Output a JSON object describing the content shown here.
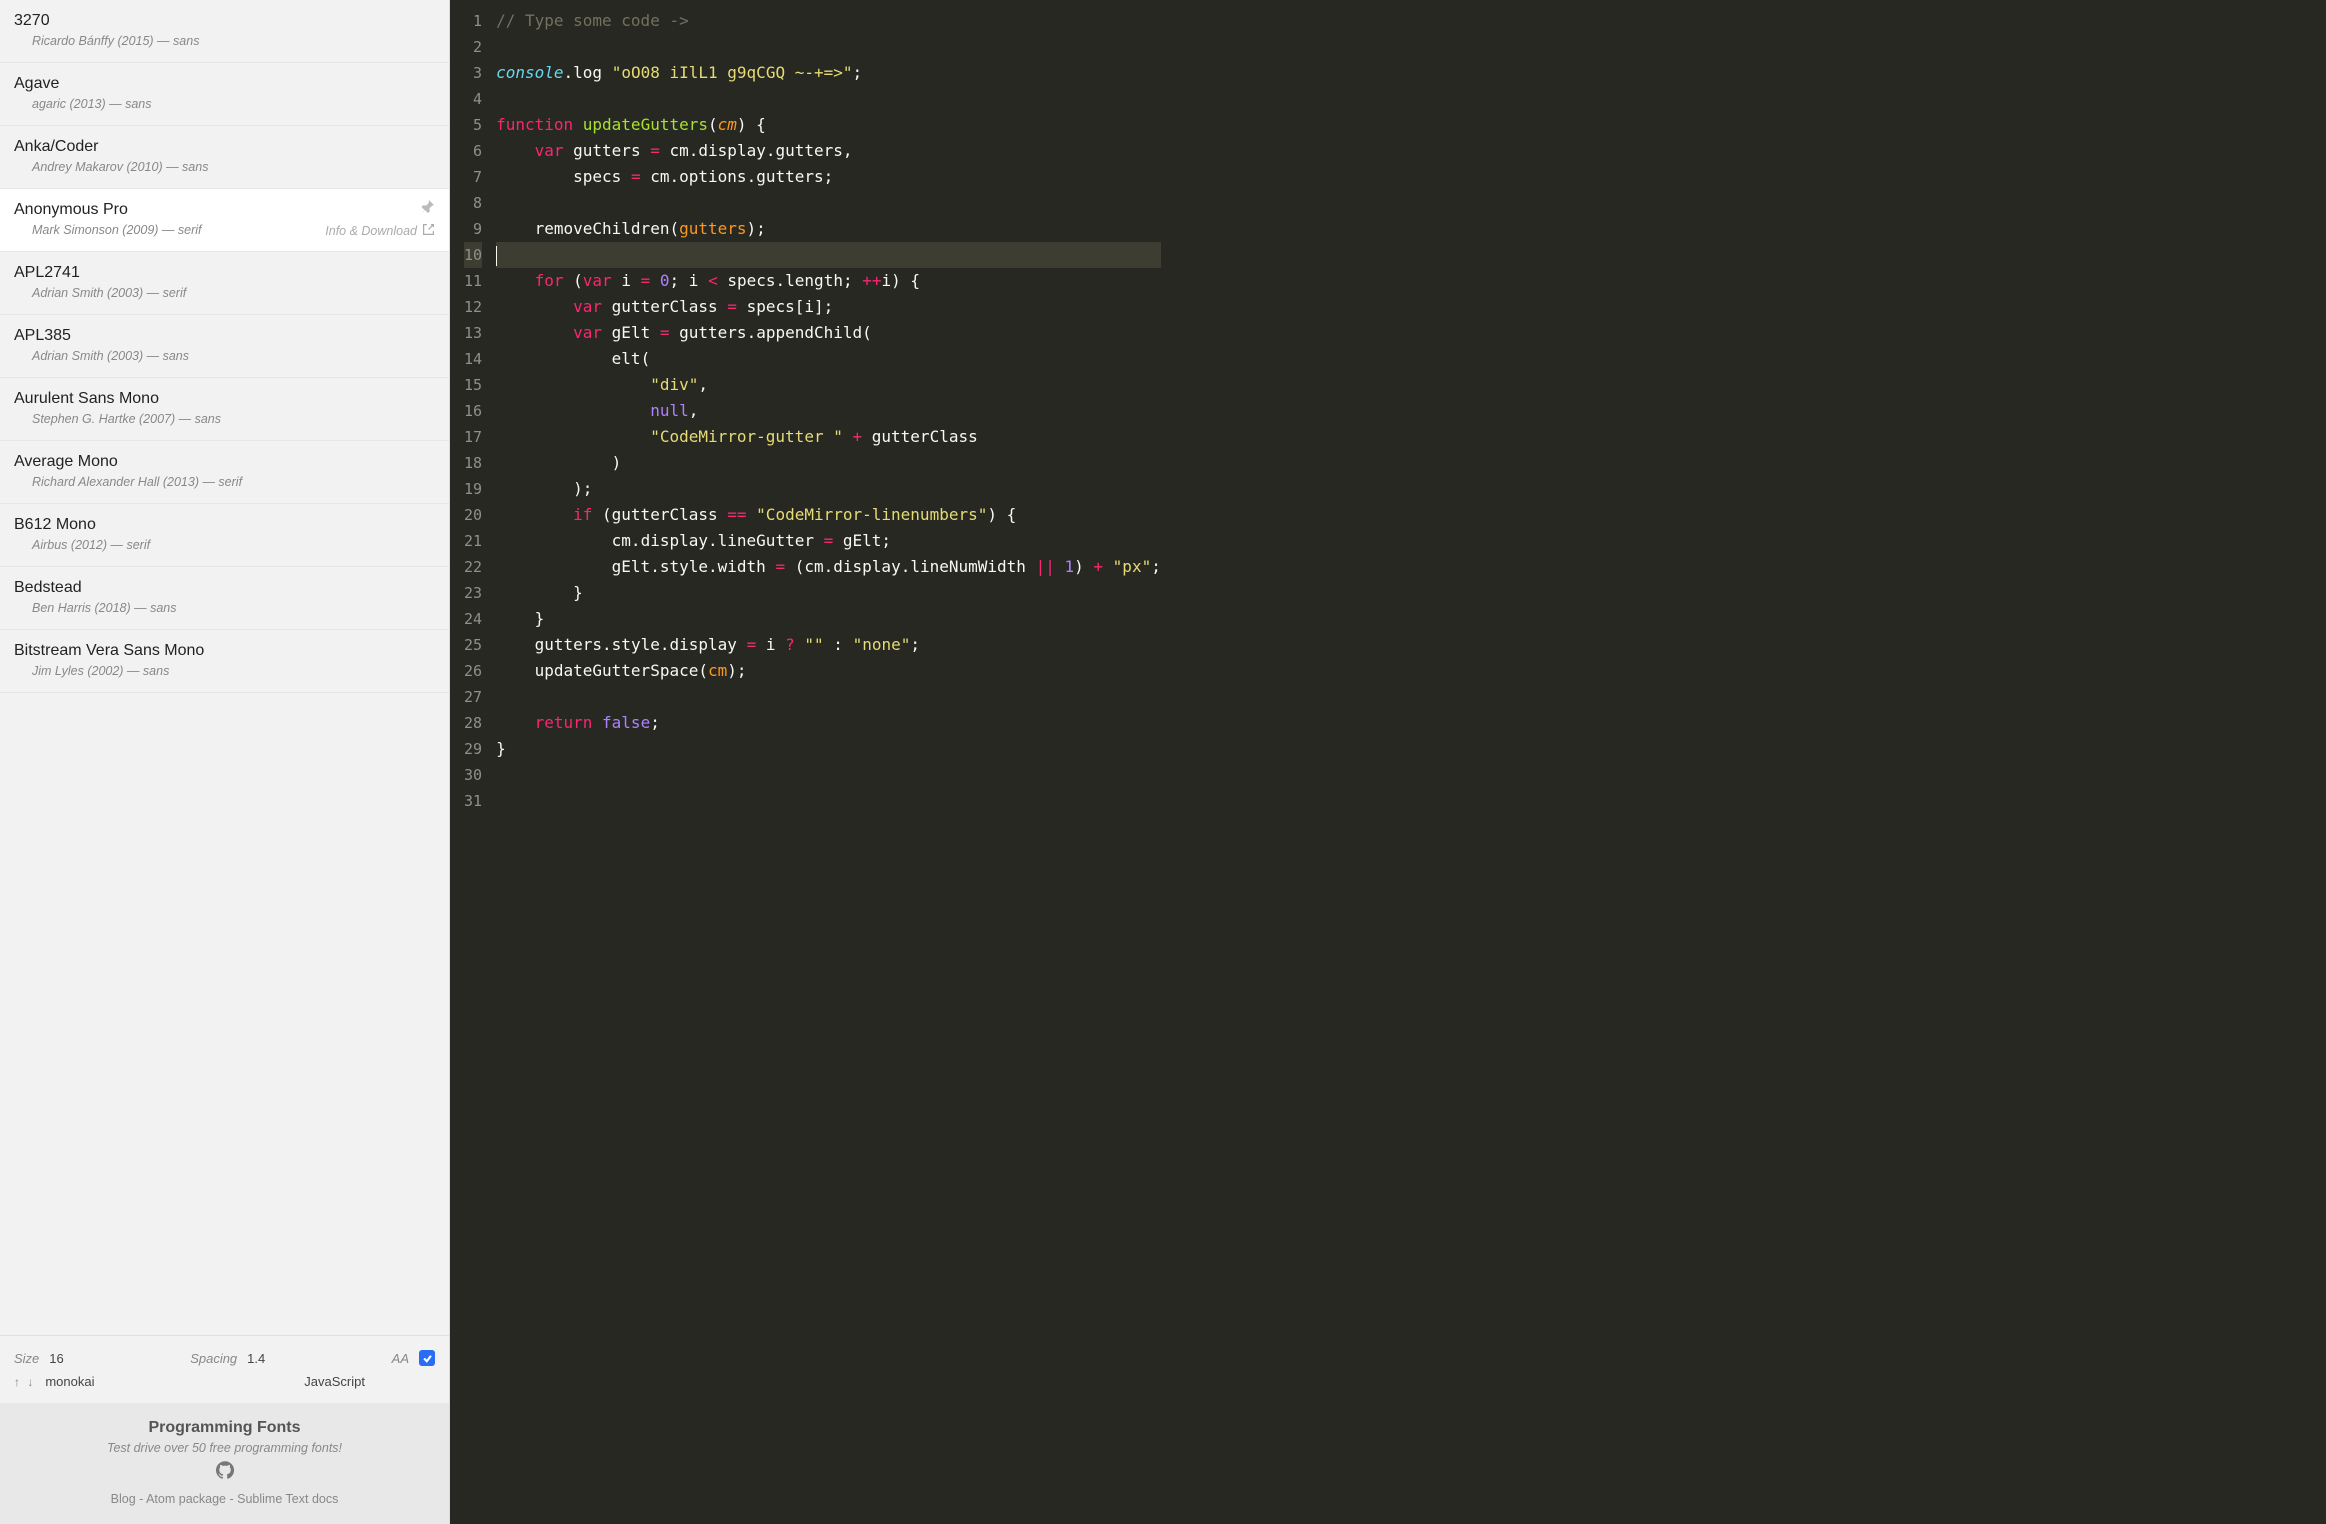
{
  "sidebar": {
    "fonts": [
      {
        "name": "3270",
        "meta": "Ricardo Bánffy (2015) — sans",
        "active": false
      },
      {
        "name": "Agave",
        "meta": "agaric (2013) — sans",
        "active": false
      },
      {
        "name": "Anka/Coder",
        "meta": "Andrey Makarov (2010) — sans",
        "active": false
      },
      {
        "name": "Anonymous Pro",
        "meta": "Mark Simonson (2009) — serif",
        "active": true,
        "info_label": "Info & Download"
      },
      {
        "name": "APL2741",
        "meta": "Adrian Smith (2003) — serif",
        "active": false
      },
      {
        "name": "APL385",
        "meta": "Adrian Smith (2003) — sans",
        "active": false
      },
      {
        "name": "Aurulent Sans Mono",
        "meta": "Stephen G. Hartke (2007) — sans",
        "active": false
      },
      {
        "name": "Average Mono",
        "meta": "Richard Alexander Hall (2013) — serif",
        "active": false
      },
      {
        "name": "B612 Mono",
        "meta": "Airbus (2012) — serif",
        "active": false
      },
      {
        "name": "Bedstead",
        "meta": "Ben Harris (2018) — sans",
        "active": false
      },
      {
        "name": "Bitstream Vera Sans Mono",
        "meta": "Jim Lyles (2002) — sans",
        "active": false
      }
    ],
    "controls": {
      "size_label": "Size",
      "size_value": "16",
      "spacing_label": "Spacing",
      "spacing_value": "1.4",
      "aa_label": "AA",
      "aa_checked": true,
      "arrows": "↑ ↓",
      "theme": "monokai",
      "language": "JavaScript"
    },
    "footer": {
      "title": "Programming Fonts",
      "subtitle": "Test drive over 50 free programming fonts!",
      "links": [
        "Blog",
        "Atom package",
        "Sublime Text docs"
      ]
    }
  },
  "editor": {
    "line_count": 31,
    "highlight_line": 10,
    "tokens": [
      [
        {
          "c": "tok-comment",
          "t": "// Type some code ->"
        }
      ],
      [],
      [
        {
          "c": "tok-builtin",
          "t": "console"
        },
        {
          "c": "tok-punc",
          "t": "."
        },
        {
          "c": "tok-call",
          "t": "log"
        },
        {
          "c": "tok-punc",
          "t": " "
        },
        {
          "c": "tok-str",
          "t": "\"oO08 iIlL1 g9qCGQ ~-+=>\""
        },
        {
          "c": "tok-punc",
          "t": ";"
        }
      ],
      [],
      [
        {
          "c": "tok-keyword",
          "t": "function"
        },
        {
          "c": "tok-punc",
          "t": " "
        },
        {
          "c": "tok-def",
          "t": "updateGutters"
        },
        {
          "c": "tok-punc",
          "t": "("
        },
        {
          "c": "tok-param",
          "t": "cm"
        },
        {
          "c": "tok-punc",
          "t": ") {"
        }
      ],
      [
        {
          "c": "tok-punc",
          "t": "    "
        },
        {
          "c": "tok-keyword",
          "t": "var"
        },
        {
          "c": "tok-punc",
          "t": " "
        },
        {
          "c": "tok-var",
          "t": "gutters"
        },
        {
          "c": "tok-punc",
          "t": " "
        },
        {
          "c": "tok-op",
          "t": "="
        },
        {
          "c": "tok-punc",
          "t": " "
        },
        {
          "c": "tok-var",
          "t": "cm"
        },
        {
          "c": "tok-punc",
          "t": "."
        },
        {
          "c": "tok-prop",
          "t": "display"
        },
        {
          "c": "tok-punc",
          "t": "."
        },
        {
          "c": "tok-prop",
          "t": "gutters"
        },
        {
          "c": "tok-punc",
          "t": ","
        }
      ],
      [
        {
          "c": "tok-punc",
          "t": "        "
        },
        {
          "c": "tok-var",
          "t": "specs"
        },
        {
          "c": "tok-punc",
          "t": " "
        },
        {
          "c": "tok-op",
          "t": "="
        },
        {
          "c": "tok-punc",
          "t": " "
        },
        {
          "c": "tok-var",
          "t": "cm"
        },
        {
          "c": "tok-punc",
          "t": "."
        },
        {
          "c": "tok-prop",
          "t": "options"
        },
        {
          "c": "tok-punc",
          "t": "."
        },
        {
          "c": "tok-prop",
          "t": "gutters"
        },
        {
          "c": "tok-punc",
          "t": ";"
        }
      ],
      [],
      [
        {
          "c": "tok-punc",
          "t": "    "
        },
        {
          "c": "tok-call",
          "t": "removeChildren"
        },
        {
          "c": "tok-punc",
          "t": "("
        },
        {
          "c": "tok-varref",
          "t": "gutters"
        },
        {
          "c": "tok-punc",
          "t": ");"
        }
      ],
      [],
      [
        {
          "c": "tok-punc",
          "t": "    "
        },
        {
          "c": "tok-keyword",
          "t": "for"
        },
        {
          "c": "tok-punc",
          "t": " ("
        },
        {
          "c": "tok-keyword",
          "t": "var"
        },
        {
          "c": "tok-punc",
          "t": " "
        },
        {
          "c": "tok-var",
          "t": "i"
        },
        {
          "c": "tok-punc",
          "t": " "
        },
        {
          "c": "tok-op",
          "t": "="
        },
        {
          "c": "tok-punc",
          "t": " "
        },
        {
          "c": "tok-num",
          "t": "0"
        },
        {
          "c": "tok-punc",
          "t": "; "
        },
        {
          "c": "tok-var",
          "t": "i"
        },
        {
          "c": "tok-punc",
          "t": " "
        },
        {
          "c": "tok-op",
          "t": "<"
        },
        {
          "c": "tok-punc",
          "t": " "
        },
        {
          "c": "tok-var",
          "t": "specs"
        },
        {
          "c": "tok-punc",
          "t": "."
        },
        {
          "c": "tok-prop",
          "t": "length"
        },
        {
          "c": "tok-punc",
          "t": "; "
        },
        {
          "c": "tok-op",
          "t": "++"
        },
        {
          "c": "tok-var",
          "t": "i"
        },
        {
          "c": "tok-punc",
          "t": ") {"
        }
      ],
      [
        {
          "c": "tok-punc",
          "t": "        "
        },
        {
          "c": "tok-keyword",
          "t": "var"
        },
        {
          "c": "tok-punc",
          "t": " "
        },
        {
          "c": "tok-var",
          "t": "gutterClass"
        },
        {
          "c": "tok-punc",
          "t": " "
        },
        {
          "c": "tok-op",
          "t": "="
        },
        {
          "c": "tok-punc",
          "t": " "
        },
        {
          "c": "tok-var",
          "t": "specs"
        },
        {
          "c": "tok-punc",
          "t": "["
        },
        {
          "c": "tok-var",
          "t": "i"
        },
        {
          "c": "tok-punc",
          "t": "];"
        }
      ],
      [
        {
          "c": "tok-punc",
          "t": "        "
        },
        {
          "c": "tok-keyword",
          "t": "var"
        },
        {
          "c": "tok-punc",
          "t": " "
        },
        {
          "c": "tok-var",
          "t": "gElt"
        },
        {
          "c": "tok-punc",
          "t": " "
        },
        {
          "c": "tok-op",
          "t": "="
        },
        {
          "c": "tok-punc",
          "t": " "
        },
        {
          "c": "tok-var",
          "t": "gutters"
        },
        {
          "c": "tok-punc",
          "t": "."
        },
        {
          "c": "tok-call",
          "t": "appendChild"
        },
        {
          "c": "tok-punc",
          "t": "("
        }
      ],
      [
        {
          "c": "tok-punc",
          "t": "            "
        },
        {
          "c": "tok-call",
          "t": "elt"
        },
        {
          "c": "tok-punc",
          "t": "("
        }
      ],
      [
        {
          "c": "tok-punc",
          "t": "                "
        },
        {
          "c": "tok-str",
          "t": "\"div\""
        },
        {
          "c": "tok-punc",
          "t": ","
        }
      ],
      [
        {
          "c": "tok-punc",
          "t": "                "
        },
        {
          "c": "tok-atom",
          "t": "null"
        },
        {
          "c": "tok-punc",
          "t": ","
        }
      ],
      [
        {
          "c": "tok-punc",
          "t": "                "
        },
        {
          "c": "tok-str",
          "t": "\"CodeMirror-gutter \""
        },
        {
          "c": "tok-punc",
          "t": " "
        },
        {
          "c": "tok-op",
          "t": "+"
        },
        {
          "c": "tok-punc",
          "t": " "
        },
        {
          "c": "tok-var",
          "t": "gutterClass"
        }
      ],
      [
        {
          "c": "tok-punc",
          "t": "            )"
        }
      ],
      [
        {
          "c": "tok-punc",
          "t": "        );"
        }
      ],
      [
        {
          "c": "tok-punc",
          "t": "        "
        },
        {
          "c": "tok-keyword",
          "t": "if"
        },
        {
          "c": "tok-punc",
          "t": " ("
        },
        {
          "c": "tok-var",
          "t": "gutterClass"
        },
        {
          "c": "tok-punc",
          "t": " "
        },
        {
          "c": "tok-op",
          "t": "=="
        },
        {
          "c": "tok-punc",
          "t": " "
        },
        {
          "c": "tok-str",
          "t": "\"CodeMirror-linenumbers\""
        },
        {
          "c": "tok-punc",
          "t": ") {"
        }
      ],
      [
        {
          "c": "tok-punc",
          "t": "            "
        },
        {
          "c": "tok-var",
          "t": "cm"
        },
        {
          "c": "tok-punc",
          "t": "."
        },
        {
          "c": "tok-prop",
          "t": "display"
        },
        {
          "c": "tok-punc",
          "t": "."
        },
        {
          "c": "tok-prop",
          "t": "lineGutter"
        },
        {
          "c": "tok-punc",
          "t": " "
        },
        {
          "c": "tok-op",
          "t": "="
        },
        {
          "c": "tok-punc",
          "t": " "
        },
        {
          "c": "tok-var",
          "t": "gElt"
        },
        {
          "c": "tok-punc",
          "t": ";"
        }
      ],
      [
        {
          "c": "tok-punc",
          "t": "            "
        },
        {
          "c": "tok-var",
          "t": "gElt"
        },
        {
          "c": "tok-punc",
          "t": "."
        },
        {
          "c": "tok-prop",
          "t": "style"
        },
        {
          "c": "tok-punc",
          "t": "."
        },
        {
          "c": "tok-prop",
          "t": "width"
        },
        {
          "c": "tok-punc",
          "t": " "
        },
        {
          "c": "tok-op",
          "t": "="
        },
        {
          "c": "tok-punc",
          "t": " ("
        },
        {
          "c": "tok-var",
          "t": "cm"
        },
        {
          "c": "tok-punc",
          "t": "."
        },
        {
          "c": "tok-prop",
          "t": "display"
        },
        {
          "c": "tok-punc",
          "t": "."
        },
        {
          "c": "tok-prop",
          "t": "lineNumWidth"
        },
        {
          "c": "tok-punc",
          "t": " "
        },
        {
          "c": "tok-op",
          "t": "||"
        },
        {
          "c": "tok-punc",
          "t": " "
        },
        {
          "c": "tok-num",
          "t": "1"
        },
        {
          "c": "tok-punc",
          "t": ") "
        },
        {
          "c": "tok-op",
          "t": "+"
        },
        {
          "c": "tok-punc",
          "t": " "
        },
        {
          "c": "tok-str",
          "t": "\"px\""
        },
        {
          "c": "tok-punc",
          "t": ";"
        }
      ],
      [
        {
          "c": "tok-punc",
          "t": "        }"
        }
      ],
      [
        {
          "c": "tok-punc",
          "t": "    }"
        }
      ],
      [
        {
          "c": "tok-punc",
          "t": "    "
        },
        {
          "c": "tok-var",
          "t": "gutters"
        },
        {
          "c": "tok-punc",
          "t": "."
        },
        {
          "c": "tok-prop",
          "t": "style"
        },
        {
          "c": "tok-punc",
          "t": "."
        },
        {
          "c": "tok-prop",
          "t": "display"
        },
        {
          "c": "tok-punc",
          "t": " "
        },
        {
          "c": "tok-op",
          "t": "="
        },
        {
          "c": "tok-punc",
          "t": " "
        },
        {
          "c": "tok-var",
          "t": "i"
        },
        {
          "c": "tok-punc",
          "t": " "
        },
        {
          "c": "tok-op",
          "t": "?"
        },
        {
          "c": "tok-punc",
          "t": " "
        },
        {
          "c": "tok-str",
          "t": "\"\""
        },
        {
          "c": "tok-punc",
          "t": " : "
        },
        {
          "c": "tok-str",
          "t": "\"none\""
        },
        {
          "c": "tok-punc",
          "t": ";"
        }
      ],
      [
        {
          "c": "tok-punc",
          "t": "    "
        },
        {
          "c": "tok-call",
          "t": "updateGutterSpace"
        },
        {
          "c": "tok-punc",
          "t": "("
        },
        {
          "c": "tok-varref",
          "t": "cm"
        },
        {
          "c": "tok-punc",
          "t": ");"
        }
      ],
      [],
      [
        {
          "c": "tok-punc",
          "t": "    "
        },
        {
          "c": "tok-keyword",
          "t": "return"
        },
        {
          "c": "tok-punc",
          "t": " "
        },
        {
          "c": "tok-atom",
          "t": "false"
        },
        {
          "c": "tok-punc",
          "t": ";"
        }
      ],
      [
        {
          "c": "tok-punc",
          "t": "}"
        }
      ],
      [],
      []
    ]
  }
}
